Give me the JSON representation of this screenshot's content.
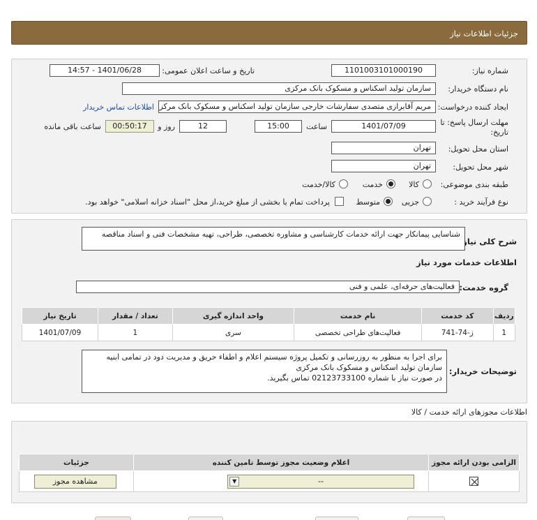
{
  "header": {
    "title": "جزئیات اطلاعات نیاز"
  },
  "main": {
    "need_no_label": "شماره نیاز:",
    "need_no": "1101003101000190",
    "announce_label": "تاریخ و ساعت اعلان عمومی:",
    "announce_value": "1401/06/28 - 14:57",
    "buyer_label": "نام دستگاه خریدار:",
    "buyer_value": "سازمان تولید اسکناس و مسکوک بانک مرکزی",
    "creator_label": "ایجاد کننده درخواست:",
    "creator_value": "مریم آقابرازی متصدی سفارشات خارجی سازمان تولید اسکناس و مسکوک بانک مرکزی",
    "contact_link": "اطلاعات تماس خریدار",
    "deadline_label_1": "مهلت ارسال پاسخ: تا",
    "deadline_label_2": "تاریخ:",
    "deadline_date": "1401/07/09",
    "time_label": "ساعت",
    "deadline_time": "15:00",
    "days_value": "12",
    "days_label": "روز و",
    "remaining_value": "00:50:17",
    "remaining_label": "ساعت باقی مانده",
    "province_label": "استان محل تحویل:",
    "province_value": "تهران",
    "city_label": "شهر محل تحویل:",
    "city_value": "تهران",
    "category_label": "طبقه بندی موضوعی:",
    "category_options": [
      "کالا",
      "خدمت",
      "کالا/خدمت"
    ],
    "category_selected": "خدمت",
    "process_label": "نوع فرآیند خرید :",
    "process_options": [
      "جزیی",
      "متوسط"
    ],
    "process_selected": "متوسط",
    "payment_note": "پرداخت تمام یا بخشی از مبلغ خرید،از محل \"اسناد خزانه اسلامی\" خواهد بود."
  },
  "desc": {
    "summary_label": "شرح کلی نیاز:",
    "summary_text": "شناسایی پیمانکار جهت ارائه خدمات کارشناسی و مشاوره تخصصی، طراحی، تهیه مشخصات فنی و اسناد مناقصه",
    "services_title": "اطلاعات خدمات مورد نیاز",
    "group_label": "گروه خدمت:",
    "group_value": "فعالیت‌های حرفه‌ای، علمی و فنی",
    "table": {
      "headers": [
        "ردیف",
        "کد خدمت",
        "نام خدمت",
        "واحد اندازه گیری",
        "تعداد / مقدار",
        "تاریخ نیاز"
      ],
      "rows": [
        [
          "1",
          "ز-74-741",
          "فعالیت‌های طراحی تخصصی",
          "سری",
          "1",
          "1401/07/09"
        ]
      ]
    },
    "buyer_notes_label": "توضیحات خریدار:",
    "buyer_notes_lines": [
      "برای اجرا به منظور به روزرسانی و تکمیل پروژه سیستم اعلام و اطفاء حریق و مدیریت دود در تمامی ابنیه",
      "سازمان تولید اسکناس و مسکوک بانک مرکزی",
      "در صورت نیاز با شماره 02123733100 تماس بگیرید."
    ]
  },
  "licenses": {
    "section_title": "اطلاعات مجوزهای ارائه خدمت / کالا",
    "headers": [
      "الزامی بودن ارائه مجوز",
      "اعلام وضعیت مجوز توسط تامین کننده",
      "جزئیات"
    ],
    "status_value": "--",
    "view_button": "مشاهده مجوز",
    "required_checked": true
  },
  "colors": {
    "header_bg": "#8b6a3e",
    "link": "#1a4fa3",
    "field_bg": "#efefd6"
  }
}
